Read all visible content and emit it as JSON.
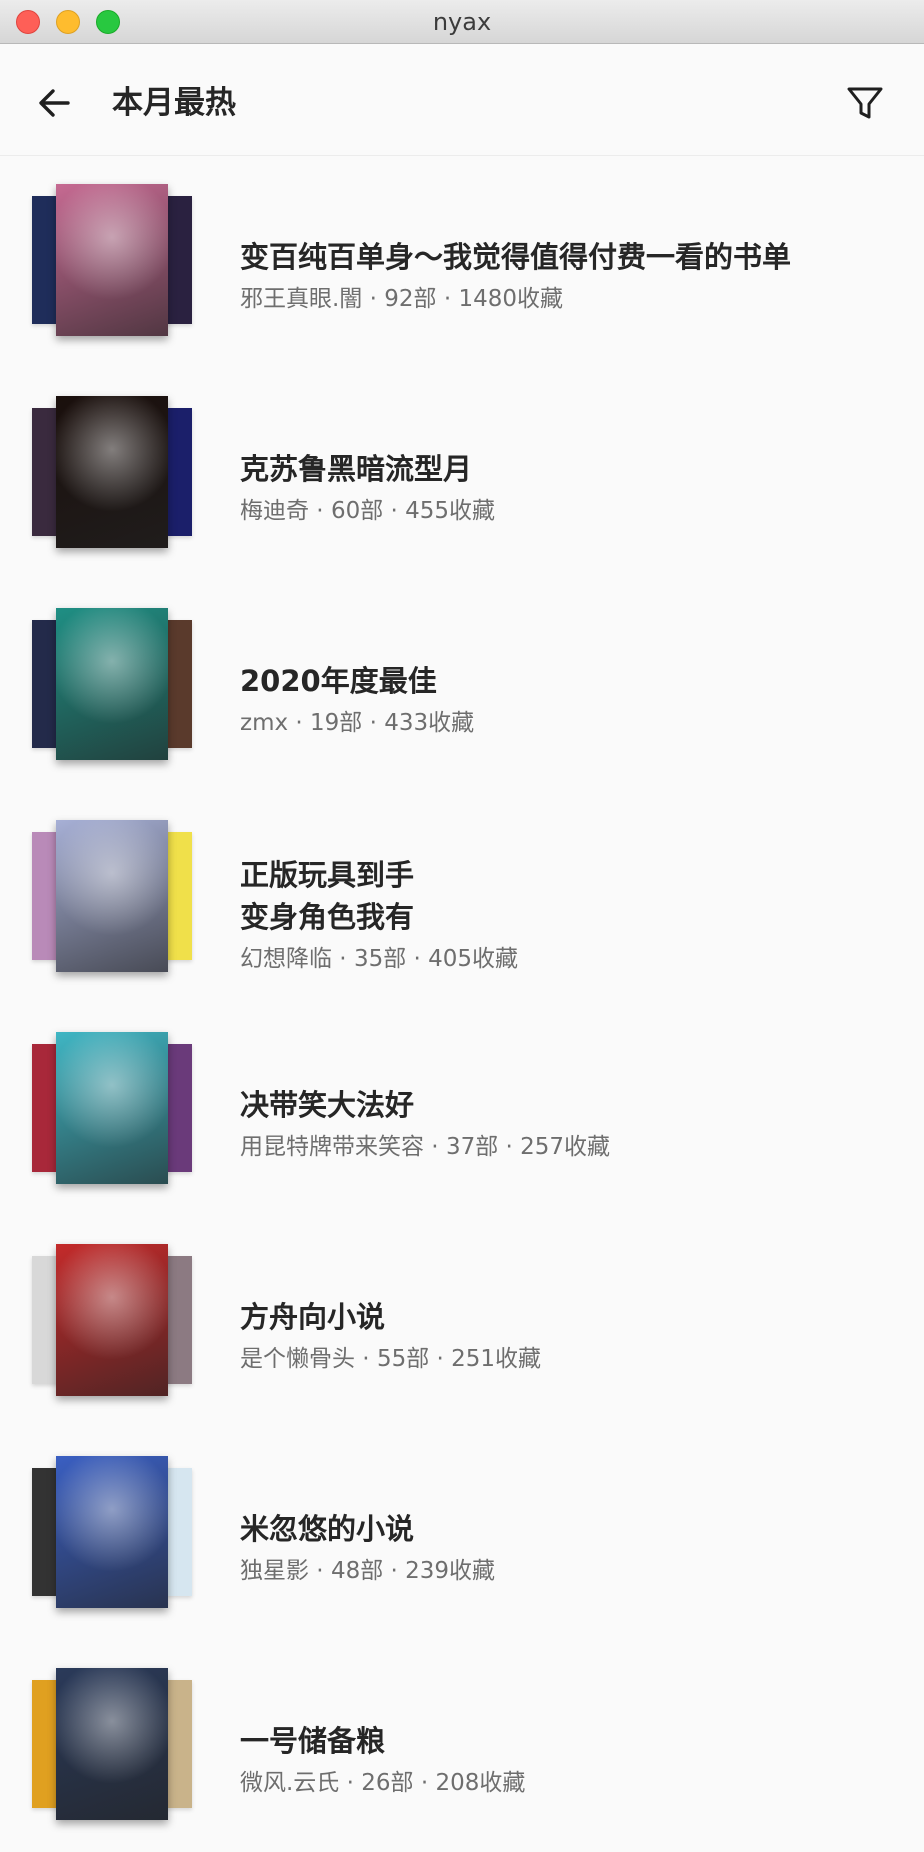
{
  "window": {
    "title": "nyax"
  },
  "appbar": {
    "title": "本月最热",
    "back_icon": "arrow-left-icon",
    "filter_icon": "filter-icon"
  },
  "booklists": [
    {
      "title": "变百纯百单身～我觉得值得付费一看的书单",
      "author": "邪王真眼.闇",
      "count": "92部",
      "favorites": "1480收藏",
      "front_color": "#c66a92",
      "back_left": "#1f2d5a",
      "back_right": "#2a2140"
    },
    {
      "title": "克苏鲁黑暗流型月",
      "author": "梅迪奇",
      "count": "60部",
      "favorites": "455收藏",
      "front_color": "#1a0f0c",
      "back_left": "#3a2a3e",
      "back_right": "#1b1f6a"
    },
    {
      "title": "2020年度最佳",
      "author": "zmx",
      "count": "19部",
      "favorites": "433收藏",
      "front_color": "#1f8f84",
      "back_left": "#232a4a",
      "back_right": "#5a3a2c"
    },
    {
      "title": "正版玩具到手\n变身角色我有",
      "author": "幻想降临",
      "count": "35部",
      "favorites": "405收藏",
      "front_color": "#a7b0d6",
      "back_left": "#b98ab8",
      "back_right": "#f0e04a"
    },
    {
      "title": "决带笑大法好",
      "author": "用昆特牌带来笑容",
      "count": "37部",
      "favorites": "257收藏",
      "front_color": "#3fb6c4",
      "back_left": "#a8283a",
      "back_right": "#6a3a7a"
    },
    {
      "title": "方舟向小说",
      "author": "是个懒骨头",
      "count": "55部",
      "favorites": "251收藏",
      "front_color": "#c42a2a",
      "back_left": "#d8d8d8",
      "back_right": "#8c7a82"
    },
    {
      "title": "米忽悠的小说",
      "author": "独星影",
      "count": "48部",
      "favorites": "239收藏",
      "front_color": "#3a5fc2",
      "back_left": "#333333",
      "back_right": "#d6e6f0"
    },
    {
      "title": "一号储备粮",
      "author": "微风.云氏",
      "count": "26部",
      "favorites": "208收藏",
      "front_color": "#2a3a5a",
      "back_left": "#e0a020",
      "back_right": "#c9b38a"
    }
  ]
}
